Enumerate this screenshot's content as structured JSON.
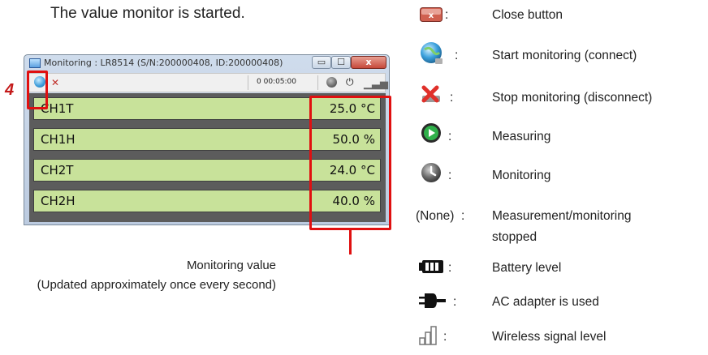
{
  "intro_text": "The value monitor is started.",
  "window": {
    "title": "Monitoring : LR8514 (S/N:200000408, ID:200000408)",
    "controls": {
      "minimize": "▭",
      "maximize": "☐",
      "close": "x"
    },
    "toolbar": {
      "elapsed_time": "0 00:05:00"
    },
    "channels": [
      {
        "name": "CH1T",
        "value": "25.0",
        "unit": "°C"
      },
      {
        "name": "CH1H",
        "value": "50.0",
        "unit": "%"
      },
      {
        "name": "CH2T",
        "value": "24.0",
        "unit": "°C"
      },
      {
        "name": "CH2H",
        "value": "40.0",
        "unit": "%"
      }
    ]
  },
  "step_number": "4",
  "callout": {
    "line1": "Monitoring value",
    "line2": "(Updated approximately once every second)"
  },
  "legend": {
    "colon": ":",
    "items": [
      {
        "icon": "close-button-icon",
        "label": "Close button"
      },
      {
        "icon": "start-monitoring-icon",
        "label": "Start monitoring (connect)"
      },
      {
        "icon": "stop-monitoring-icon",
        "label": "Stop monitoring (disconnect)"
      },
      {
        "icon": "measuring-icon",
        "label": "Measuring"
      },
      {
        "icon": "monitoring-icon",
        "label": "Monitoring"
      },
      {
        "icon_text": "(None)",
        "label_line1": "Measurement/monitoring",
        "label_line2": "stopped"
      },
      {
        "icon": "battery-level-icon",
        "label": "Battery level"
      },
      {
        "icon": "ac-adapter-icon",
        "label": "AC adapter is used"
      },
      {
        "icon": "wireless-signal-icon",
        "label": "Wireless signal level"
      }
    ]
  },
  "colors": {
    "value_row_fill": "#c8e29a",
    "callout_red": "#e01010",
    "step_red": "#c41a1a"
  }
}
